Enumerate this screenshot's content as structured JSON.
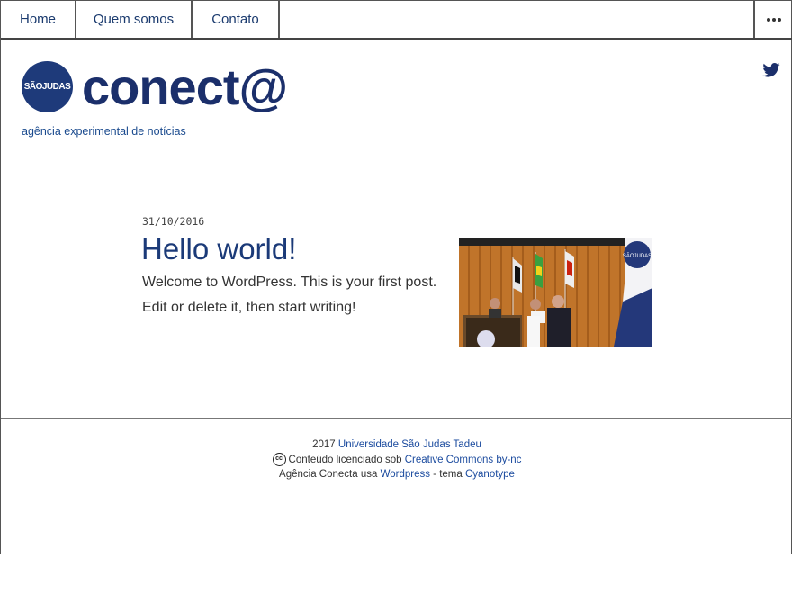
{
  "nav": {
    "items": [
      {
        "label": "Home"
      },
      {
        "label": "Quem somos"
      },
      {
        "label": "Contato"
      }
    ],
    "more_icon": "more-horizontal-icon"
  },
  "header": {
    "badge_text": "SÃOJUDAS",
    "logo_text": "conect@",
    "tagline": "agência experimental de notícias",
    "social_icon": "twitter-icon",
    "brand_color": "#1b2f6b"
  },
  "post": {
    "date": "31/10/2016",
    "title": "Hello world!",
    "excerpt": "Welcome to WordPress. This is your first post. Edit or delete it, then start writing!",
    "image_badge_text": "SÃOJUDAS"
  },
  "footer": {
    "year": "2017",
    "university_link": "Universidade São Judas Tadeu",
    "license_prefix": "Conteúdo licenciado sob",
    "license_link": "Creative Commons by-nc",
    "credits_prefix": "Agência Conecta usa",
    "wordpress_link": "Wordpress",
    "theme_text": "- tema",
    "theme_link": "Cyanotype",
    "cc_icon_text": "cc"
  }
}
